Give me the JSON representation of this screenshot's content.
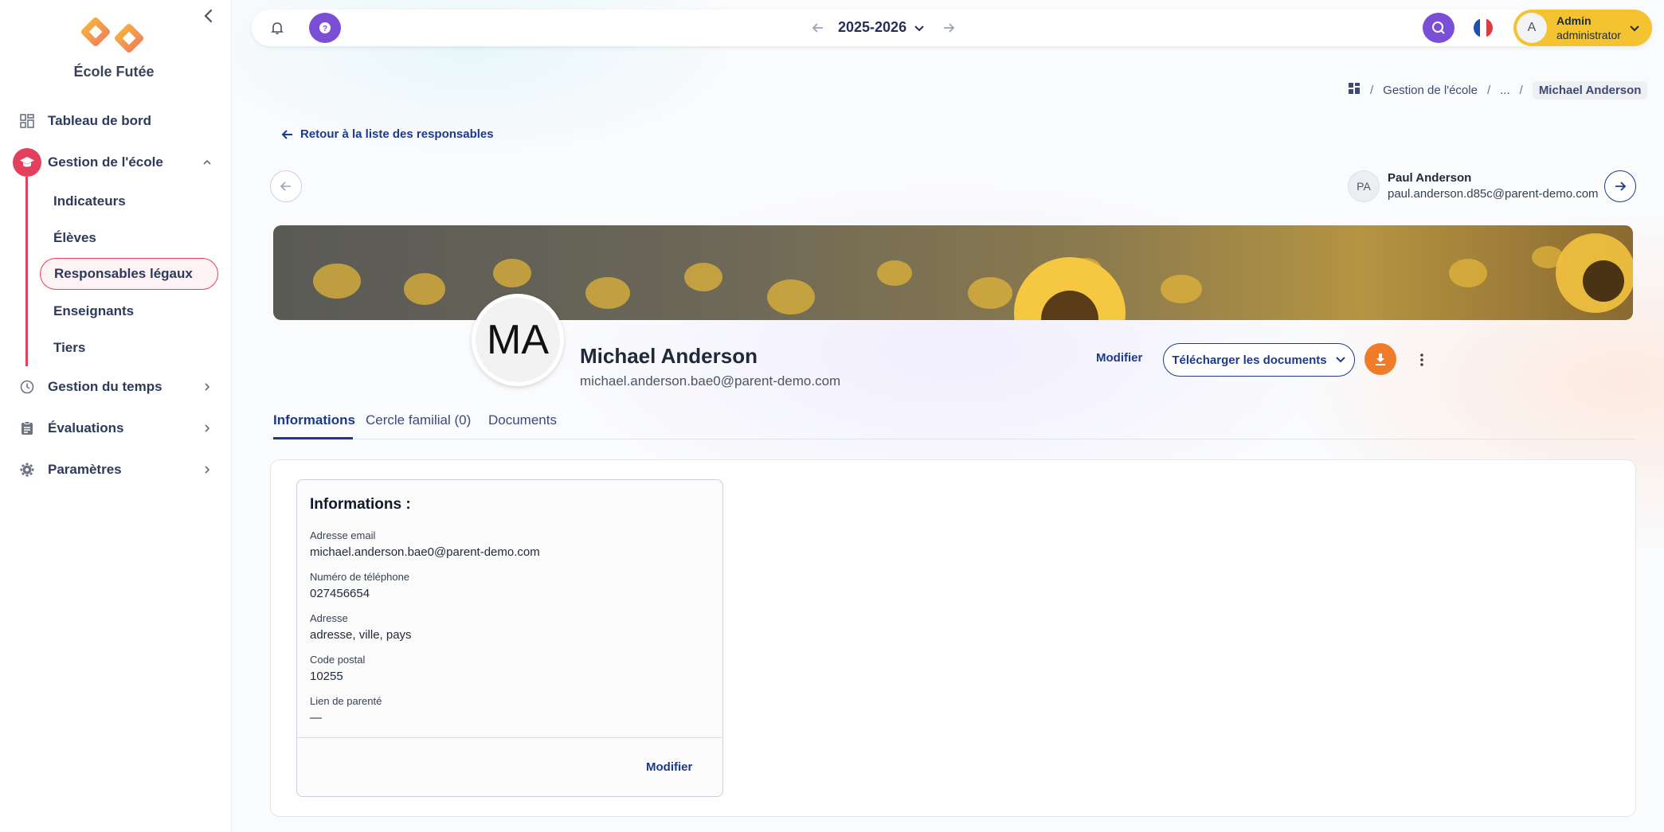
{
  "sidebar": {
    "brand": "École Futée",
    "items": [
      {
        "label": "Tableau de bord"
      },
      {
        "label": "Gestion de l'école"
      },
      {
        "label": "Gestion du temps"
      },
      {
        "label": "Évaluations"
      },
      {
        "label": "Paramètres"
      }
    ],
    "subitems": [
      {
        "label": "Indicateurs"
      },
      {
        "label": "Élèves"
      },
      {
        "label": "Responsables légaux"
      },
      {
        "label": "Enseignants"
      },
      {
        "label": "Tiers"
      }
    ]
  },
  "topbar": {
    "year": "2025-2026",
    "user": {
      "initial": "A",
      "name": "Admin",
      "role": "administrator"
    }
  },
  "breadcrumb": {
    "section": "Gestion de l'école",
    "ellipsis": "...",
    "current": "Michael Anderson",
    "separator": "/"
  },
  "back_link": "Retour à la liste des responsables",
  "next_person": {
    "initials": "PA",
    "name": "Paul Anderson",
    "email": "paul.anderson.d85c@parent-demo.com"
  },
  "profile": {
    "initials": "MA",
    "name": "Michael Anderson",
    "email": "michael.anderson.bae0@parent-demo.com"
  },
  "actions": {
    "edit": "Modifier",
    "download_docs": "Télécharger les documents"
  },
  "tabs": [
    {
      "label": "Informations"
    },
    {
      "label": "Cercle familial (0)"
    },
    {
      "label": "Documents"
    }
  ],
  "info_card": {
    "title": "Informations :",
    "fields": [
      {
        "label": "Adresse email",
        "value": "michael.anderson.bae0@parent-demo.com"
      },
      {
        "label": "Numéro de téléphone",
        "value": "027456654"
      },
      {
        "label": "Adresse",
        "value": "adresse, ville, pays"
      },
      {
        "label": "Code postal",
        "value": "10255"
      },
      {
        "label": "Lien de parenté",
        "value": "—"
      }
    ],
    "edit": "Modifier"
  },
  "colors": {
    "accent": "#e3405e",
    "primary": "#1d3a8a",
    "purple": "#7a4fd6",
    "orange": "#f07c2a",
    "yellow": "#f4c430"
  }
}
